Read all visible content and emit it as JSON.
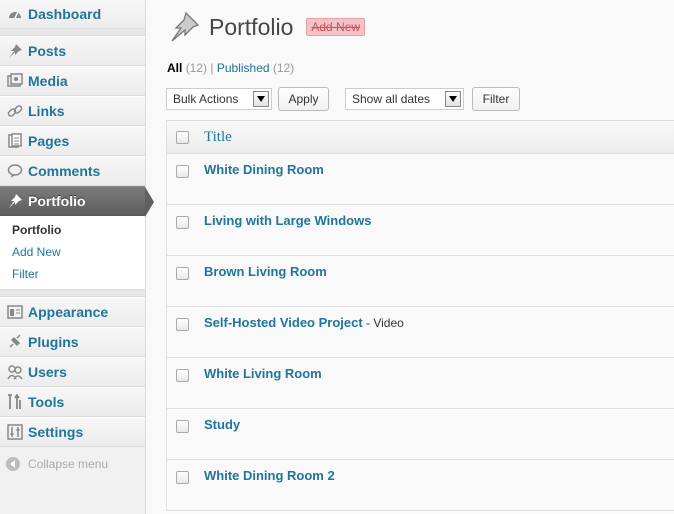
{
  "sidebar": {
    "dashboard": "Dashboard",
    "posts": "Posts",
    "media": "Media",
    "links": "Links",
    "pages": "Pages",
    "comments": "Comments",
    "portfolio": "Portfolio",
    "submenu": {
      "portfolio": "Portfolio",
      "add_new": "Add New",
      "filter": "Filter"
    },
    "appearance": "Appearance",
    "plugins": "Plugins",
    "users": "Users",
    "tools": "Tools",
    "settings": "Settings",
    "collapse": "Collapse menu"
  },
  "header": {
    "title": "Portfolio",
    "add_new": "Add New"
  },
  "views": {
    "all_label": "All",
    "all_count": "(12)",
    "sep": "|",
    "published_label": "Published",
    "published_count": "(12)"
  },
  "controls": {
    "bulk_actions": "Bulk Actions",
    "apply": "Apply",
    "dates": "Show all dates",
    "filter": "Filter"
  },
  "table": {
    "column_title": "Title",
    "rows": [
      {
        "title": "White Dining Room",
        "state": ""
      },
      {
        "title": "Living with Large Windows",
        "state": ""
      },
      {
        "title": "Brown Living Room",
        "state": ""
      },
      {
        "title": "Self-Hosted Video Project",
        "state": " - Video"
      },
      {
        "title": "White Living Room",
        "state": ""
      },
      {
        "title": "Study",
        "state": ""
      },
      {
        "title": "White Dining Room 2",
        "state": ""
      }
    ]
  },
  "colors": {
    "link": "#21759b",
    "current_menu": "#5f5f5f",
    "add_new_bg": "#f3c3c8"
  }
}
